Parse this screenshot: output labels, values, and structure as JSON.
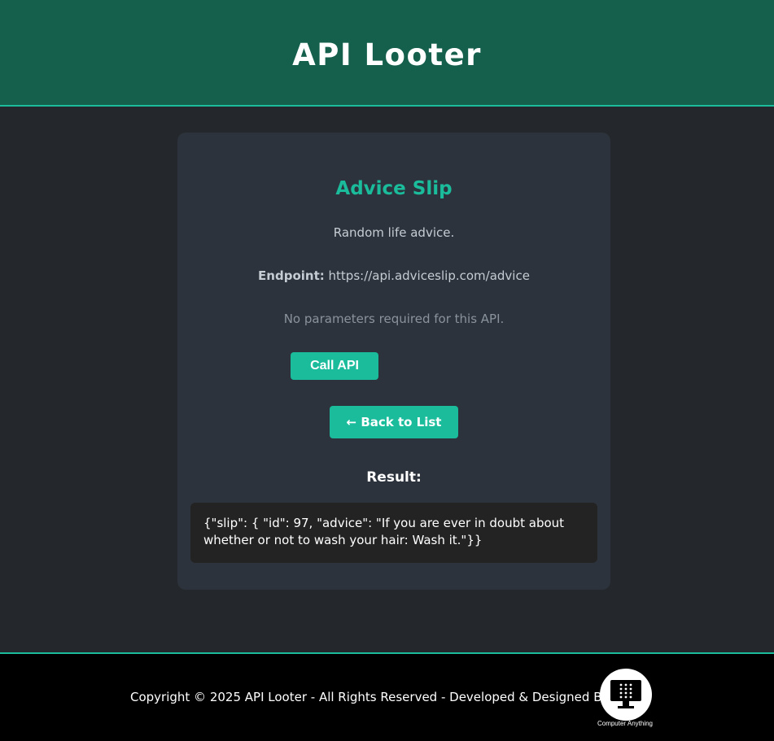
{
  "header": {
    "title": "API Looter"
  },
  "card": {
    "title": "Advice Slip",
    "description": "Random life advice.",
    "endpoint_label": "Endpoint:",
    "endpoint_url": "https://api.adviceslip.com/advice",
    "no_params_text": "No parameters required for this API.",
    "call_button_label": "Call API",
    "back_button_label": "← Back to List",
    "result_title": "Result:",
    "result_text": "{\"slip\": { \"id\": 97, \"advice\": \"If you are ever in doubt about whether or not to wash your hair: Wash it.\"}}"
  },
  "footer": {
    "copyright": "Copyright © 2025 API Looter - All Rights Reserved - Developed & Designed By:",
    "logo_text": "Computer Anything",
    "logo_icon": "computer-monitor-icon"
  },
  "colors": {
    "header_bg": "#14604d",
    "accent": "#1abc9c",
    "page_bg": "#24272b",
    "card_bg": "#2d333c",
    "result_bg": "#242323",
    "footer_bg": "#000000"
  }
}
